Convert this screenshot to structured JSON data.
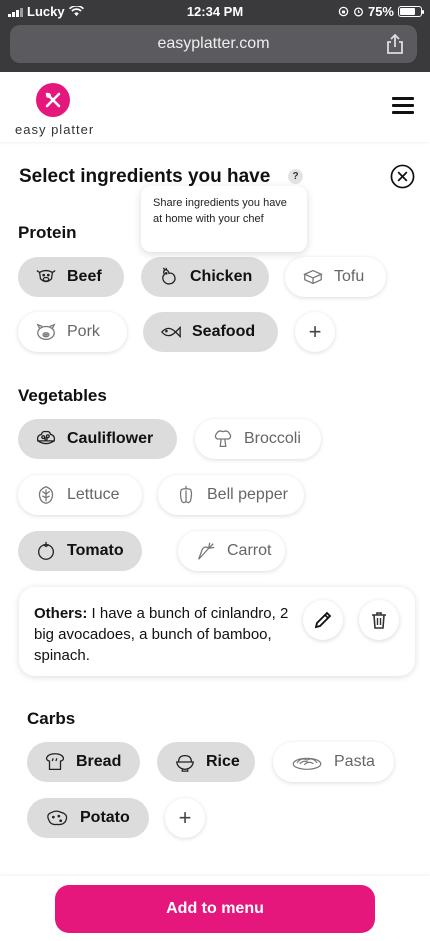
{
  "status_bar": {
    "carrier": "Lucky",
    "time": "12:34 PM",
    "battery": "75%",
    "battery_level": 0.75
  },
  "browser": {
    "url": "easyplatter.com"
  },
  "header": {
    "brand": "easy platter",
    "brand_color": "#e6177c"
  },
  "page": {
    "title": "Select ingredients you have",
    "help": "?",
    "tooltip": "Share ingredients you have at home with your chef"
  },
  "protein": {
    "title": "Protein",
    "chips": [
      {
        "label": "Beef",
        "icon": "beef-icon",
        "selected": true
      },
      {
        "label": "Chicken",
        "icon": "chicken-icon",
        "selected": true
      },
      {
        "label": "Tofu",
        "icon": "tofu-icon",
        "selected": false
      },
      {
        "label": "Pork",
        "icon": "pork-icon",
        "selected": false
      },
      {
        "label": "Seafood",
        "icon": "fish-icon",
        "selected": true
      }
    ],
    "add": "+"
  },
  "vegetables": {
    "title": "Vegetables",
    "chips": [
      {
        "label": "Cauliflower",
        "icon": "cauliflower-icon",
        "selected": true
      },
      {
        "label": "Broccoli",
        "icon": "broccoli-icon",
        "selected": false
      },
      {
        "label": "Lettuce",
        "icon": "lettuce-icon",
        "selected": false
      },
      {
        "label": "Bell pepper",
        "icon": "bell-pepper-icon",
        "selected": false
      },
      {
        "label": "Tomato",
        "icon": "tomato-icon",
        "selected": true
      },
      {
        "label": "Carrot",
        "icon": "carrot-icon",
        "selected": false
      }
    ]
  },
  "others": {
    "label": "Others:",
    "text": " I have a bunch of cinlandro,  2 big avocadoes, a bunch of bamboo, spinach."
  },
  "carbs": {
    "title": "Carbs",
    "chips": [
      {
        "label": "Bread",
        "icon": "bread-icon",
        "selected": true
      },
      {
        "label": "Rice",
        "icon": "rice-bowl-icon",
        "selected": true
      },
      {
        "label": "Pasta",
        "icon": "pasta-icon",
        "selected": false
      },
      {
        "label": "Potato",
        "icon": "potato-icon",
        "selected": true
      }
    ],
    "add": "+"
  },
  "cta": {
    "label": "Add to menu"
  }
}
